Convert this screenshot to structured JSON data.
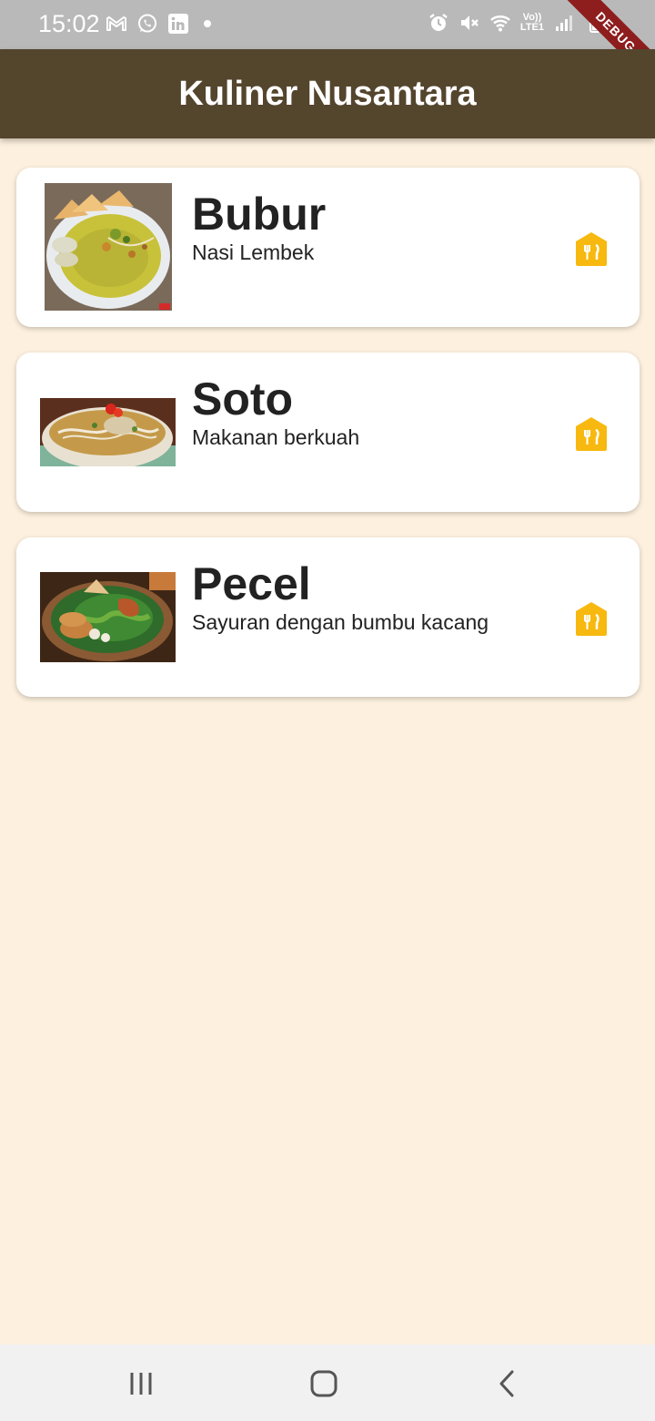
{
  "status_bar": {
    "time": "15:02",
    "left_icons": [
      "gmail-icon",
      "whatsapp-icon",
      "linkedin-icon",
      "notification-dot-icon"
    ],
    "right_icons": [
      "alarm-icon",
      "mute-icon",
      "wifi-icon",
      "volte-icon",
      "signal-icon",
      "battery-icon"
    ],
    "volte_line1": "Vo))",
    "volte_line2": "LTE1"
  },
  "debug_banner": "DEBUG",
  "app_bar": {
    "title": "Kuliner Nusantara"
  },
  "items": [
    {
      "title": "Bubur",
      "subtitle": "Nasi Lembek",
      "image": "bubur-photo",
      "icon": "food-badge-icon"
    },
    {
      "title": "Soto",
      "subtitle": "Makanan berkuah",
      "image": "soto-photo",
      "icon": "food-badge-icon"
    },
    {
      "title": "Pecel",
      "subtitle": "Sayuran dengan bumbu kacang",
      "image": "pecel-photo",
      "icon": "food-badge-icon"
    }
  ],
  "colors": {
    "app_bar": "#54452d",
    "background": "#fdf0de",
    "card": "#ffffff",
    "badge": "#f7b90f",
    "status_bar": "#b9b9b9",
    "debug": "#8e1d1d"
  },
  "nav_bar": {
    "buttons": [
      "recent-apps-icon",
      "home-icon",
      "back-icon"
    ]
  }
}
